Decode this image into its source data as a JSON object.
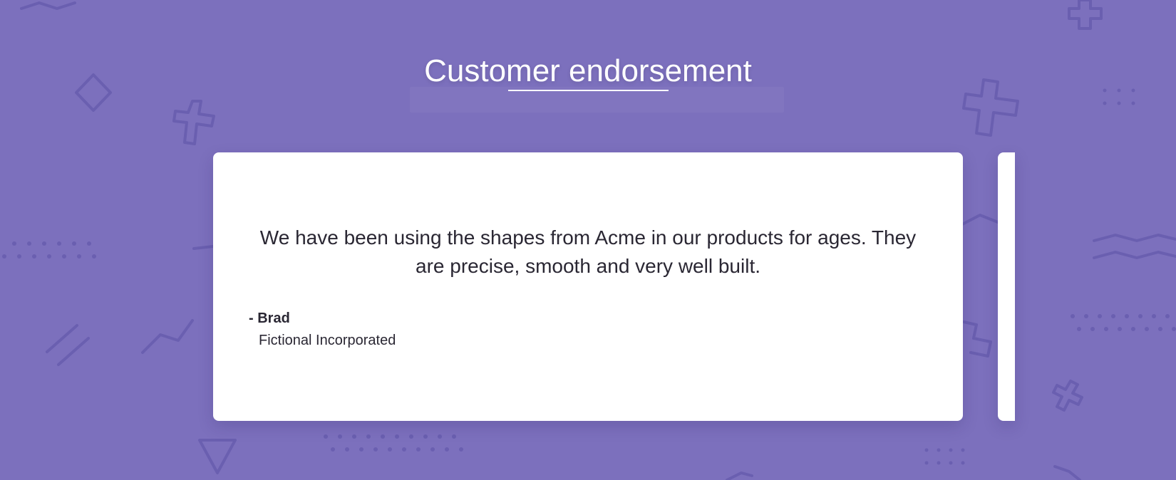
{
  "colors": {
    "background": "#7c70bd",
    "decoration": "#6a5fb0",
    "card": "#ffffff",
    "text": "#2a2733"
  },
  "section": {
    "title": "Customer endorsement"
  },
  "testimonial": {
    "quote": "We have been using the shapes from Acme in our products for ages. They are precise, smooth and very well built.",
    "author": "- Brad",
    "company": "Fictional Incorporated"
  },
  "decorations": [
    "diamond-icon",
    "plus-icon",
    "triangle-icon",
    "zigzag-icon",
    "dot-grid-icon",
    "slash-lines-icon"
  ]
}
